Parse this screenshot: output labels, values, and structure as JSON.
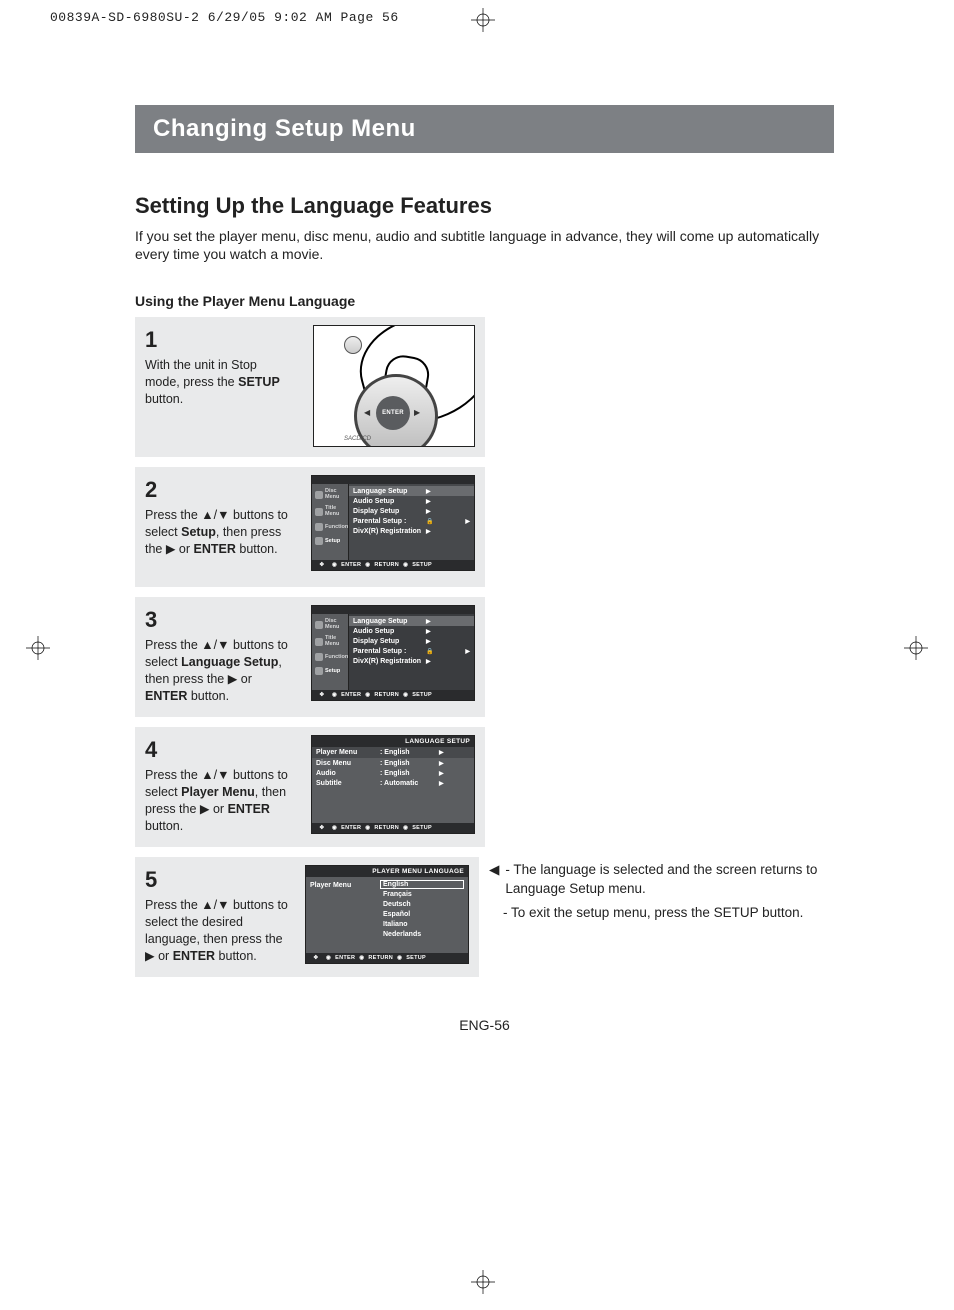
{
  "meta": {
    "header_line": "00839A-SD-6980SU-2  6/29/05  9:02 AM  Page 56"
  },
  "banner": "Changing Setup Menu",
  "section_title": "Setting Up the Language Features",
  "intro": "If you set the player menu, disc menu, audio and subtitle language in advance, they will come up automatically every time you watch a movie.",
  "sub_heading": "Using the Player Menu Language",
  "steps": {
    "s1": {
      "num": "1",
      "text_a": "With the unit in Stop mode, press the ",
      "text_b": "SETUP",
      "text_c": " button.",
      "remote_center": "ENTER",
      "remote_footer": "SACD/CD"
    },
    "s2": {
      "num": "2",
      "text_a": "Press the ▲/▼ buttons to select ",
      "text_b": "Setup",
      "text_c": ", then press the ▶ or ",
      "text_d": "ENTER",
      "text_e": " button."
    },
    "s3": {
      "num": "3",
      "text_a": "Press the ▲/▼ buttons to select ",
      "text_b": "Language Setup",
      "text_c": ", then press the ▶ or ",
      "text_d": "ENTER",
      "text_e": " button."
    },
    "s4": {
      "num": "4",
      "text_a": "Press the ▲/▼ buttons to select ",
      "text_b": "Player Menu",
      "text_c": ", then press the ▶ or ",
      "text_d": "ENTER",
      "text_e": " button."
    },
    "s5": {
      "num": "5",
      "text_a": "Press the ▲/▼ buttons to select the desired language, then press the ▶ or ",
      "text_b": "ENTER",
      "text_c": " button."
    }
  },
  "osd": {
    "tabs": {
      "t1": "Disc Menu",
      "t2": "Title Menu",
      "t3": "Function",
      "t4": "Setup"
    },
    "main_menu": {
      "i1": "Language Setup",
      "i2": "Audio Setup",
      "i3": "Display Setup",
      "i4": "Parental Setup :",
      "i5": "DivX(R) Registration"
    },
    "lang_setup": {
      "title": "LANGUAGE SETUP",
      "r1l": "Player Menu",
      "r1v": ": English",
      "r2l": "Disc Menu",
      "r2v": ": English",
      "r3l": "Audio",
      "r3v": ": English",
      "r4l": "Subtitle",
      "r4v": ": Automatic"
    },
    "player_lang": {
      "title": "PLAYER MENU LANGUAGE",
      "rowlabel": "Player Menu",
      "l1": "English",
      "l2": "Français",
      "l3": "Deutsch",
      "l4": "Español",
      "l5": "Italiano",
      "l6": "Nederlands"
    },
    "footer": {
      "enter": "ENTER",
      "return": "RETURN",
      "setup": "SETUP"
    }
  },
  "notes": {
    "bullet": "◀",
    "dash": "-",
    "n1": "- The language is selected and the screen returns to Language Setup menu.",
    "n2": "- To exit the setup menu, press the SETUP button."
  },
  "page_num": "ENG-56"
}
